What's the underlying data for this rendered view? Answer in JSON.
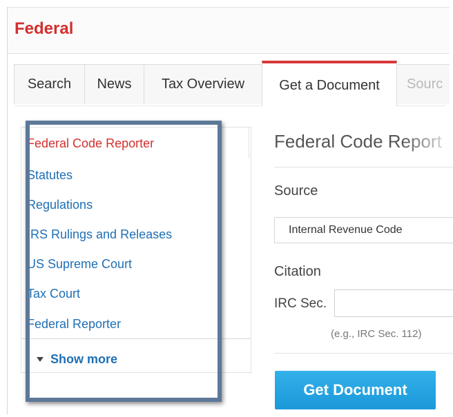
{
  "app": {
    "title": "Federal",
    "accent": "#d32f2f"
  },
  "tabs": [
    {
      "label": "Search"
    },
    {
      "label": "News"
    },
    {
      "label": "Tax Overview"
    },
    {
      "label": "Get a Document",
      "active": true
    },
    {
      "label": "Sourc"
    }
  ],
  "left_nav": {
    "items": [
      {
        "label": "Federal Code Reporter",
        "active": true
      },
      {
        "label": "Statutes"
      },
      {
        "label": "Regulations"
      },
      {
        "label": "IRS Rulings and Releases"
      },
      {
        "label": "US Supreme Court"
      },
      {
        "label": "Tax Court"
      },
      {
        "label": "Federal Reporter"
      }
    ],
    "show_more": "Show more",
    "link_color": "#1f6fb4"
  },
  "form": {
    "title": "Federal Code Report",
    "source_label": "Source",
    "source_value": "Internal Revenue Code",
    "citation_label": "Citation",
    "irc_label": "IRC Sec.",
    "irc_value": "",
    "hint": "(e.g., IRC Sec. 112)",
    "submit": "Get Document",
    "button_color": "#1b98d9"
  },
  "highlight_color": "#5d7898"
}
